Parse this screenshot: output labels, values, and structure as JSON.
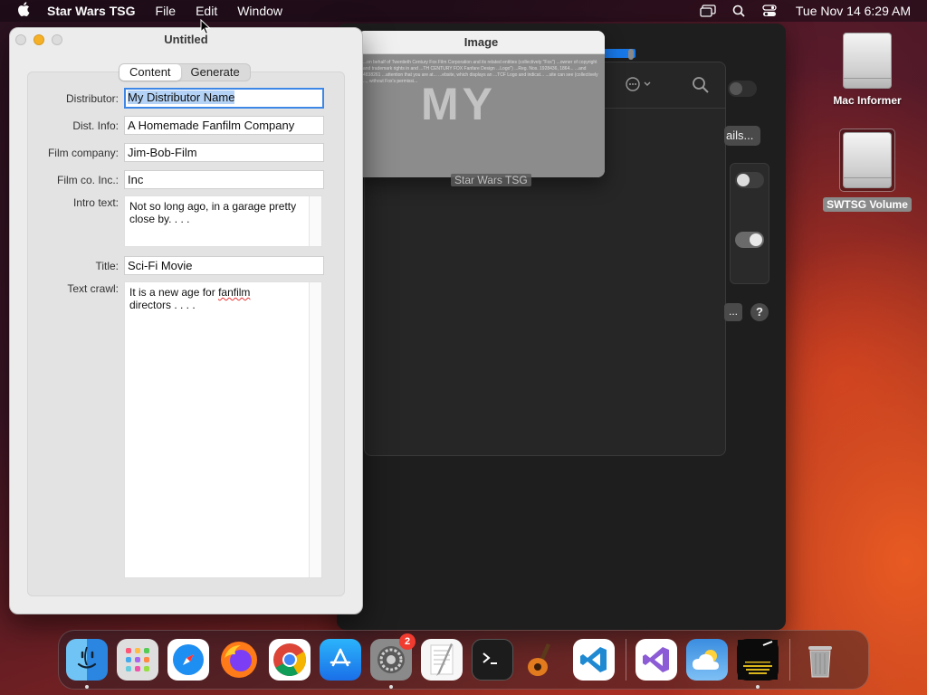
{
  "menubar": {
    "app_name": "Star Wars TSG",
    "menus": [
      "File",
      "Edit",
      "Window"
    ],
    "clock": "Tue Nov 14  6:29 AM"
  },
  "image_window": {
    "title": "Image",
    "fine_print": "...on behalf of Twentieth Century Fox Film Corporation and its related entities (collectively \"Fox\") ...owner of copyright and trademark rights in and ...TH CENTURY FOX Fanfare Design ...Logo\") ...Reg. Nos. 1928436, 1864... ...and 4838261 ...attention that you are at... ...ebsite, which displays an ...TCF Logo and indicat... ...site can see (collectively ..., without Fox's permissi...",
    "watermark": "MY",
    "caption": "Star Wars TSG"
  },
  "background_window": {
    "details_button": "ails...",
    "ellipsis_button": "...",
    "help_button": "?"
  },
  "main_window": {
    "title": "Untitled",
    "tabs": [
      {
        "label": "Content",
        "active": true
      },
      {
        "label": "Generate",
        "active": false
      }
    ],
    "fields": {
      "distributor": {
        "label": "Distributor:",
        "value": "My Distributor Name"
      },
      "dist_info": {
        "label": "Dist. Info:",
        "value": "A Homemade Fanfilm Company"
      },
      "film_company": {
        "label": "Film company:",
        "value": "Jim-Bob-Film"
      },
      "film_co_inc": {
        "label": "Film co. Inc.:",
        "value": "Inc"
      },
      "intro_text": {
        "label": "Intro text:",
        "value": "Not so long ago, in a garage pretty close by. . . ."
      },
      "title": {
        "label": "Title:",
        "value": "Sci-Fi Movie"
      },
      "text_crawl": {
        "label": "Text crawl:",
        "value_pre": "It is a new age for ",
        "value_mark": "fanfilm",
        "value_post": "\ndirectors . . . ."
      }
    }
  },
  "desktop": {
    "icons": [
      {
        "label": "Mac Informer"
      },
      {
        "label": "SWTSG Volume"
      }
    ]
  },
  "dock": {
    "apps": [
      "Finder",
      "Launchpad",
      "Safari",
      "Firefox",
      "Chrome",
      "App Store",
      "System Settings",
      "TextEdit",
      "Terminal",
      "GarageBand",
      "Visual Studio Code",
      "Visual Studio",
      "Weather",
      "Star Wars TSG",
      "Trash"
    ],
    "settings_badge": "2"
  }
}
